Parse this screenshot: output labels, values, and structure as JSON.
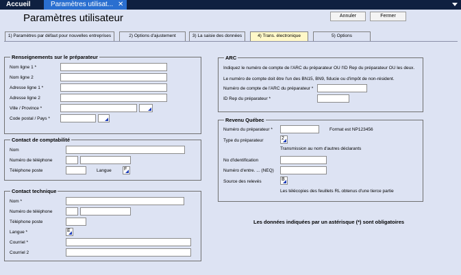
{
  "topbar": {
    "home_tab": "Accueil",
    "active_tab": "Paramètres utilisat...",
    "close_glyph": "✕"
  },
  "page": {
    "title": "Paramètres utilisateur"
  },
  "toolbar": {
    "cancel": "Annuler",
    "close": "Fermer"
  },
  "tabs": [
    {
      "label": "1) Paramètres par défaut pour nouvelles entreprises"
    },
    {
      "label": "2) Options d'ajustement"
    },
    {
      "label": "3) La saisie des données"
    },
    {
      "label": "4) Trans. électronique"
    },
    {
      "label": "5) Options"
    }
  ],
  "preparer": {
    "title": "Renseignements sur le préparateur",
    "name1": "Nom ligne 1 *",
    "name2": "Nom ligne 2",
    "addr1": "Adresse ligne 1 *",
    "addr2": "Adresse ligne 2",
    "city": "Ville / Province *",
    "postal": "Code postal / Pays *"
  },
  "accounting": {
    "title": "Contact de comptabilité",
    "name": "Nom",
    "phone": "Numéro de téléphone",
    "ext": "Téléphone poste",
    "lang": "Langue",
    "lang_value": "F"
  },
  "technical": {
    "title": "Contact technique",
    "name": "Nom *",
    "phone": "Numéro de téléphone",
    "ext": "Téléphone poste",
    "lang": "Langue *",
    "lang_value": "E",
    "email": "Courriel *",
    "email2": "Courriel 2"
  },
  "arc": {
    "title": "ARC",
    "note1": "Indiquez le numéro de compte de l'ARC du préparateur OU l'ID Rep du préparateur OU les deux.",
    "note2": "Le numéro de compte doit être l'un des BN15, BN9, fiducie ou d'impôt de non-résident.",
    "account": "Numéro de compte de l'ARC du préparateur *",
    "rep_id": "ID Rep du préparateur *"
  },
  "rq": {
    "title": "Revenu Québec",
    "prep_no": "Numéro du préparateur *",
    "format": "Format est NP123456",
    "prep_type": "Type du préparateur",
    "prep_type_value": "2",
    "transmission": "Transmission au nom d'autres déclarants",
    "id_no": "No d'identification",
    "neq": "Numéro d'entre. ... (NEQ)",
    "source": "Source des relevés",
    "source_value": "B",
    "source_note": "Les télécopies des feuillets RL obtenus d'une tierce partie"
  },
  "footer": {
    "required": "Les données indiquées par un astérisque (*) sont obligatoires"
  }
}
